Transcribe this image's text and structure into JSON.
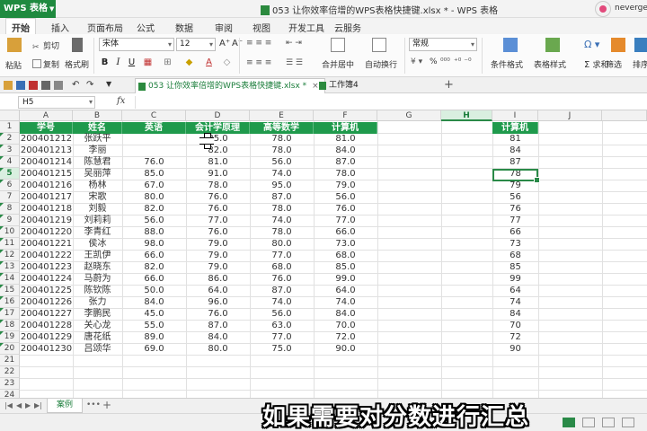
{
  "window": {
    "app_menu_label": "WPS 表格",
    "title": "053 让你效率倍增的WPS表格快捷键.xlsx * - WPS 表格",
    "user_name": "neverge"
  },
  "ribbon_tabs": [
    "开始",
    "插入",
    "页面布局",
    "公式",
    "数据",
    "审阅",
    "视图",
    "开发工具",
    "云服务"
  ],
  "ribbon": {
    "paste_label": "粘贴",
    "cut_label": "剪切",
    "copy_label": "复制",
    "format_painter_label": "格式刷",
    "font_name": "宋体",
    "font_size": "12",
    "bold": "B",
    "italic": "I",
    "underline": "U",
    "merge_label": "合并居中",
    "wrap_label": "自动换行",
    "number_format": "常规",
    "percent": "%",
    "cond_format_label": "条件格式",
    "table_style_label": "表格样式",
    "sum_label": "求和",
    "filter_label": "筛选",
    "sort_label": "排序"
  },
  "doc_tabs": [
    {
      "label": "053 让你效率倍增的WPS表格快捷键.xlsx *",
      "close": "×"
    },
    {
      "label": "工作簿4"
    }
  ],
  "new_tab_label": "+",
  "formula_bar": {
    "cell_ref": "H5",
    "fx": "fx",
    "content": ""
  },
  "columns": [
    "A",
    "B",
    "C",
    "D",
    "E",
    "F",
    "G",
    "H",
    "I",
    "J"
  ],
  "selected_column": "H",
  "selected_row": "5",
  "table_headers": [
    "学号",
    "姓名",
    "英语",
    "会计学原理",
    "高等数学",
    "计算机"
  ],
  "aux_header": "计算机",
  "rows": [
    {
      "id": "200401212",
      "name": "张跃平",
      "english": "",
      "accounting": "85.0",
      "math": "78.0",
      "cs": "81.0",
      "aux": "81"
    },
    {
      "id": "200401213",
      "name": "李丽",
      "english": "",
      "accounting": "82.0",
      "math": "78.0",
      "cs": "84.0",
      "aux": "84"
    },
    {
      "id": "200401214",
      "name": "陈慧君",
      "english": "76.0",
      "accounting": "81.0",
      "math": "56.0",
      "cs": "87.0",
      "aux": "87"
    },
    {
      "id": "200401215",
      "name": "吴丽萍",
      "english": "85.0",
      "accounting": "91.0",
      "math": "74.0",
      "cs": "78.0",
      "aux": "78"
    },
    {
      "id": "200401216",
      "name": "杨林",
      "english": "67.0",
      "accounting": "78.0",
      "math": "95.0",
      "cs": "79.0",
      "aux": "79"
    },
    {
      "id": "200401217",
      "name": "宋歌",
      "english": "80.0",
      "accounting": "76.0",
      "math": "87.0",
      "cs": "56.0",
      "aux": "56"
    },
    {
      "id": "200401218",
      "name": "刘毅",
      "english": "82.0",
      "accounting": "76.0",
      "math": "78.0",
      "cs": "76.0",
      "aux": "76"
    },
    {
      "id": "200401219",
      "name": "刘莉莉",
      "english": "56.0",
      "accounting": "77.0",
      "math": "74.0",
      "cs": "77.0",
      "aux": "77"
    },
    {
      "id": "200401220",
      "name": "李青红",
      "english": "88.0",
      "accounting": "76.0",
      "math": "78.0",
      "cs": "66.0",
      "aux": "66"
    },
    {
      "id": "200401221",
      "name": "侯冰",
      "english": "98.0",
      "accounting": "79.0",
      "math": "80.0",
      "cs": "73.0",
      "aux": "73"
    },
    {
      "id": "200401222",
      "name": "王凯伊",
      "english": "66.0",
      "accounting": "79.0",
      "math": "77.0",
      "cs": "68.0",
      "aux": "68"
    },
    {
      "id": "200401223",
      "name": "赵晓东",
      "english": "82.0",
      "accounting": "79.0",
      "math": "68.0",
      "cs": "85.0",
      "aux": "85"
    },
    {
      "id": "200401224",
      "name": "马蔚为",
      "english": "66.0",
      "accounting": "86.0",
      "math": "76.0",
      "cs": "99.0",
      "aux": "99"
    },
    {
      "id": "200401225",
      "name": "陈钦陈",
      "english": "50.0",
      "accounting": "64.0",
      "math": "87.0",
      "cs": "64.0",
      "aux": "64"
    },
    {
      "id": "200401226",
      "name": "张力",
      "english": "84.0",
      "accounting": "96.0",
      "math": "74.0",
      "cs": "74.0",
      "aux": "74"
    },
    {
      "id": "200401227",
      "name": "李鹏民",
      "english": "45.0",
      "accounting": "76.0",
      "math": "56.0",
      "cs": "84.0",
      "aux": "84"
    },
    {
      "id": "200401228",
      "name": "关心龙",
      "english": "55.0",
      "accounting": "87.0",
      "math": "63.0",
      "cs": "70.0",
      "aux": "70"
    },
    {
      "id": "200401229",
      "name": "唐花纸",
      "english": "89.0",
      "accounting": "84.0",
      "math": "77.0",
      "cs": "72.0",
      "aux": "72"
    },
    {
      "id": "200401230",
      "name": "吕颂华",
      "english": "69.0",
      "accounting": "80.0",
      "math": "75.0",
      "cs": "90.0",
      "aux": "90"
    }
  ],
  "row_numbers": [
    "1",
    "2",
    "3",
    "4",
    "5",
    "6",
    "7",
    "8",
    "9",
    "10",
    "11",
    "12",
    "13",
    "14",
    "15",
    "16",
    "17",
    "18",
    "19",
    "20",
    "21",
    "22",
    "23",
    "24"
  ],
  "sheet_tab": "案例",
  "sheet_more": "•••",
  "sheet_add": "+",
  "subtitle": "如果需要对分数进行汇总",
  "colors": {
    "accent": "#1f9a4c",
    "brand": "#1f8a3f",
    "selection": "#2a8a48"
  }
}
